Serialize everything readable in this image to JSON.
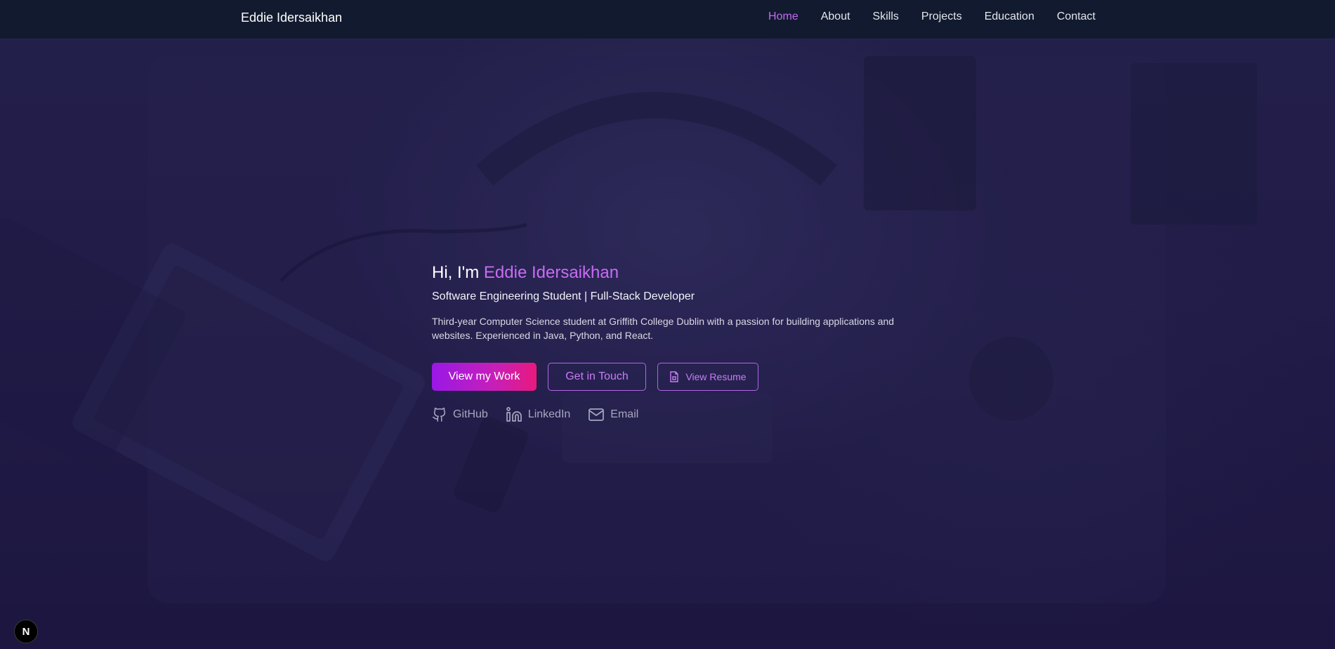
{
  "nav": {
    "brand": "Eddie Idersaikhan",
    "links": [
      {
        "label": "Home",
        "active": true
      },
      {
        "label": "About",
        "active": false
      },
      {
        "label": "Skills",
        "active": false
      },
      {
        "label": "Projects",
        "active": false
      },
      {
        "label": "Education",
        "active": false
      },
      {
        "label": "Contact",
        "active": false
      }
    ]
  },
  "hero": {
    "greeting": "Hi, I'm ",
    "name": "Eddie Idersaikhan",
    "subtitle": "Software Engineering Student | Full-Stack Developer",
    "description": "Third-year Computer Science student at Griffith College Dublin with a passion for building applications and websites. Experienced in Java, Python, and React.",
    "buttons": {
      "primary": "View my Work",
      "contact": "Get in Touch",
      "resume": "View Resume"
    },
    "social": [
      {
        "label": "GitHub",
        "icon": "github-icon"
      },
      {
        "label": "LinkedIn",
        "icon": "linkedin-icon"
      },
      {
        "label": "Email",
        "icon": "mail-icon"
      }
    ]
  },
  "badge": {
    "label": "N"
  },
  "colors": {
    "accent": "#c86cf3",
    "nav_bg": "#111a2e",
    "page_bg": "#211c48",
    "gradient_start": "#9a18e6",
    "gradient_end": "#e8197e"
  }
}
